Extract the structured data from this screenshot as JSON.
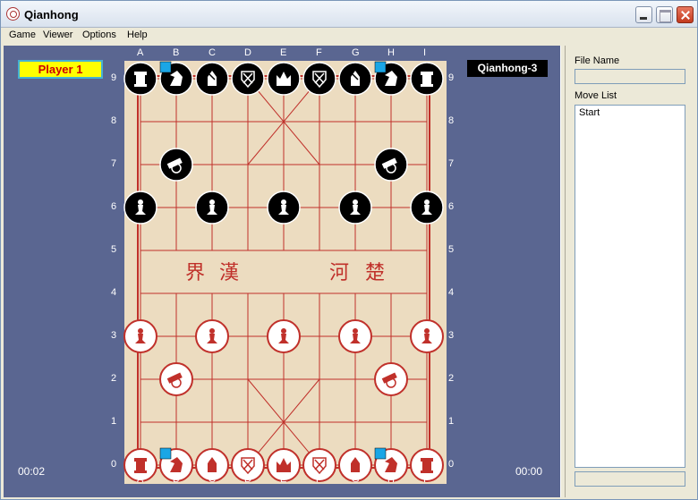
{
  "window": {
    "title": "Qianhong"
  },
  "menu": [
    "Game",
    "Viewer",
    "Options",
    "Help"
  ],
  "players": {
    "left": "Player 1",
    "right": "Qianhong-3"
  },
  "timers": {
    "left": "00:02",
    "right": "00:00"
  },
  "side_panel": {
    "file_name_label": "File Name",
    "file_name_value": "",
    "move_list_label": "Move List",
    "moves": [
      "Start"
    ]
  },
  "board": {
    "files": [
      "A",
      "B",
      "C",
      "D",
      "E",
      "F",
      "G",
      "H",
      "I"
    ],
    "ranks": [
      "0",
      "1",
      "2",
      "3",
      "4",
      "5",
      "6",
      "7",
      "8",
      "9"
    ],
    "river_text": [
      "界",
      "漢",
      "河",
      "楚"
    ],
    "colors": {
      "board": "#ecdcc0",
      "line": "#c0302a",
      "red_piece": "#c0302a",
      "black_piece": "#000000",
      "last_move_marker": "#1aa6e6"
    },
    "pieces": [
      {
        "color": "black",
        "type": "rook",
        "file": "A",
        "rank": "9"
      },
      {
        "color": "black",
        "type": "horse",
        "file": "B",
        "rank": "9"
      },
      {
        "color": "black",
        "type": "elephant",
        "file": "C",
        "rank": "9"
      },
      {
        "color": "black",
        "type": "advisor",
        "file": "D",
        "rank": "9"
      },
      {
        "color": "black",
        "type": "king",
        "file": "E",
        "rank": "9"
      },
      {
        "color": "black",
        "type": "advisor",
        "file": "F",
        "rank": "9"
      },
      {
        "color": "black",
        "type": "elephant",
        "file": "G",
        "rank": "9"
      },
      {
        "color": "black",
        "type": "horse",
        "file": "H",
        "rank": "9"
      },
      {
        "color": "black",
        "type": "rook",
        "file": "I",
        "rank": "9"
      },
      {
        "color": "black",
        "type": "cannon",
        "file": "B",
        "rank": "7"
      },
      {
        "color": "black",
        "type": "cannon",
        "file": "H",
        "rank": "7"
      },
      {
        "color": "black",
        "type": "pawn",
        "file": "A",
        "rank": "6"
      },
      {
        "color": "black",
        "type": "pawn",
        "file": "C",
        "rank": "6"
      },
      {
        "color": "black",
        "type": "pawn",
        "file": "E",
        "rank": "6"
      },
      {
        "color": "black",
        "type": "pawn",
        "file": "G",
        "rank": "6"
      },
      {
        "color": "black",
        "type": "pawn",
        "file": "I",
        "rank": "6"
      },
      {
        "color": "red",
        "type": "pawn",
        "file": "A",
        "rank": "3"
      },
      {
        "color": "red",
        "type": "pawn",
        "file": "C",
        "rank": "3"
      },
      {
        "color": "red",
        "type": "pawn",
        "file": "E",
        "rank": "3"
      },
      {
        "color": "red",
        "type": "pawn",
        "file": "G",
        "rank": "3"
      },
      {
        "color": "red",
        "type": "pawn",
        "file": "I",
        "rank": "3"
      },
      {
        "color": "red",
        "type": "cannon",
        "file": "B",
        "rank": "2"
      },
      {
        "color": "red",
        "type": "cannon",
        "file": "H",
        "rank": "2"
      },
      {
        "color": "red",
        "type": "rook",
        "file": "A",
        "rank": "0"
      },
      {
        "color": "red",
        "type": "horse",
        "file": "B",
        "rank": "0"
      },
      {
        "color": "red",
        "type": "elephant",
        "file": "C",
        "rank": "0"
      },
      {
        "color": "red",
        "type": "advisor",
        "file": "D",
        "rank": "0"
      },
      {
        "color": "red",
        "type": "king",
        "file": "E",
        "rank": "0"
      },
      {
        "color": "red",
        "type": "advisor",
        "file": "F",
        "rank": "0"
      },
      {
        "color": "red",
        "type": "elephant",
        "file": "G",
        "rank": "0"
      },
      {
        "color": "red",
        "type": "horse",
        "file": "H",
        "rank": "0"
      },
      {
        "color": "red",
        "type": "rook",
        "file": "I",
        "rank": "0"
      }
    ],
    "markers": [
      {
        "file": "B",
        "rank": "9"
      },
      {
        "file": "H",
        "rank": "9"
      },
      {
        "file": "B",
        "rank": "0"
      },
      {
        "file": "H",
        "rank": "0"
      }
    ]
  }
}
